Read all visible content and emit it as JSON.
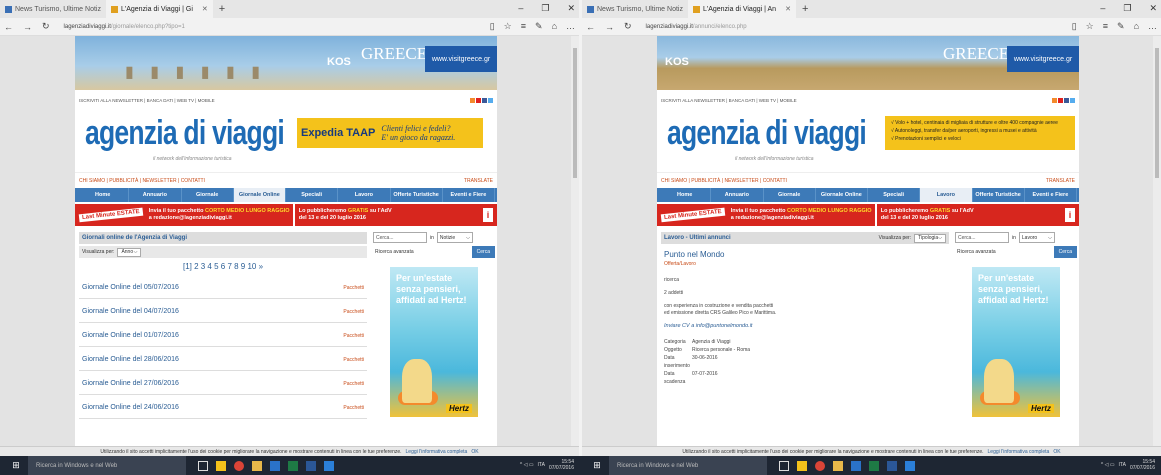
{
  "left": {
    "tabs": [
      {
        "label": "News Turismo, Ultime Notiz",
        "active": false
      },
      {
        "label": "L'Agenzia di Viaggi | Gi",
        "active": true
      }
    ],
    "url_host": "lagenziadiviaggi.it",
    "url_path": "/giornale/elenco.php?tipo=1",
    "banner": {
      "kos": "KOS",
      "greece": "GREECE",
      "site": "www.visitgreece.gr"
    },
    "toplinks": "ISCRIVITI ALLA NEWSLETTER | BANCA DATI | WEB TV | MOBILE",
    "logo": "agenzia di viaggi",
    "logo_sub": "il network dell'informazione turistica",
    "ad": {
      "brand": "Expedia TAAP",
      "line1": "Clienti felici e fedeli?",
      "line2": "E' un gioco da ragazzi."
    },
    "nav1": {
      "links": "CHI SIAMO | PUBBLICITÀ | NEWSLETTER | CONTATTI",
      "translate": "TRANSLATE"
    },
    "menu": [
      "Home",
      "Annuario",
      "Giornale",
      "Giornale Online",
      "Speciali",
      "Lavoro",
      "Offerte Turistiche",
      "Eventi e Fiere"
    ],
    "menu_selected": 3,
    "promo": {
      "badge": "Last Minute ESTATE",
      "a1": "Invia il tuo pacchetto",
      "a_hl": "CORTO  MEDIO  LUNGO RAGGIO",
      "a2": "a redazione@lagenziadiviaggi.it",
      "b1": "Lo pubblicheremo",
      "b_hl": "GRATIS",
      "b2": "su l'AdV",
      "b3": "del 13 e del 20 luglio 2016"
    },
    "section_title": "Giornali online de l'Agenzia di Viaggi",
    "view_label": "Visualizza per:",
    "view_value": "Anno",
    "pages": "[1] 2 3 4 5 6 7 8 9 10 »",
    "rows": [
      {
        "title": "Giornale Online del 05/07/2016",
        "tag": "Pacchetti"
      },
      {
        "title": "Giornale Online del 04/07/2016",
        "tag": "Pacchetti"
      },
      {
        "title": "Giornale Online del 01/07/2016",
        "tag": "Pacchetti"
      },
      {
        "title": "Giornale Online del 28/06/2016",
        "tag": "Pacchetti"
      },
      {
        "title": "Giornale Online del 27/06/2016",
        "tag": "Pacchetti"
      },
      {
        "title": "Giornale Online del 24/06/2016",
        "tag": "Pacchetti"
      }
    ],
    "search": {
      "placeholder": "Cerca...",
      "in": "in",
      "scope": "Notizie",
      "button": "Cerca",
      "advanced": "Ricerca avanzata"
    },
    "hertz": {
      "line1": "Per un'estate",
      "line2": "senza pensieri,",
      "line3": "affidati ad Hertz!",
      "brand": "Hertz"
    }
  },
  "right": {
    "tabs": [
      {
        "label": "News Turismo, Ultime Notiz",
        "active": false
      },
      {
        "label": "L'Agenzia di Viaggi | An",
        "active": true
      }
    ],
    "url_host": "lagenziadiviaggi.it",
    "url_path": "/annunci/elenco.php",
    "banner": {
      "kos": "KOS",
      "greece": "GREECE",
      "site": "www.visitgreece.gr"
    },
    "toplinks": "ISCRIVITI ALLA NEWSLETTER | BANCA DATI | WEB TV | MOBILE",
    "logo": "agenzia di viaggi",
    "logo_sub": "il network dell'informazione turistica",
    "ad_lines": [
      "√ Volo + hotel, centinaia di migliaia di strutture e oltre 400 compagnie aeree",
      "√ Autonoleggi, transfer da/per aeroporti, ingressi a musei e attività",
      "√ Prenotazioni semplici e veloci"
    ],
    "nav1": {
      "links": "CHI SIAMO | PUBBLICITÀ | NEWSLETTER | CONTATTI",
      "translate": "TRANSLATE"
    },
    "menu": [
      "Home",
      "Annuario",
      "Giornale",
      "Giornale Online",
      "Speciali",
      "Lavoro",
      "Offerte Turistiche",
      "Eventi e Fiere"
    ],
    "menu_selected": 5,
    "promo": {
      "badge": "Last Minute ESTATE",
      "a1": "Invia il tuo pacchetto",
      "a_hl": "CORTO  MEDIO  LUNGO RAGGIO",
      "a2": "a redazione@lagenziadiviaggi.it",
      "b1": "Lo pubblicheremo",
      "b_hl": "GRATIS",
      "b2": "su l'AdV",
      "b3": "del 13 e del 20 luglio 2016"
    },
    "section_title": "Lavoro - Ultimi annunci",
    "view_label": "Visualizza per:",
    "view_value": "Tipologia",
    "job": {
      "title": "Punto nel Mondo",
      "sub": "Offerta/Lavoro",
      "ricerca": "ricerca",
      "addetti": "2 addetti",
      "desc1": "con esperienza in costruzione e vendita pacchetti",
      "desc2": "ed emissione diretta CRS Galileo Pico e Marittima.",
      "cv": "Inviare CV a info@puntonelmondo.it",
      "fields": [
        {
          "k": "Categoria",
          "v": "Agenzia di Viaggi"
        },
        {
          "k": "Oggetto",
          "v": "Ricerca personale - Roma"
        },
        {
          "k": "Data inserimento",
          "v": "30-06-2016"
        },
        {
          "k": "Data scadenza",
          "v": "07-07-2016"
        }
      ]
    },
    "search": {
      "placeholder": "Cerca...",
      "in": "in",
      "scope": "Lavoro",
      "button": "Cerca",
      "advanced": "Ricerca avanzata"
    },
    "hertz": {
      "line1": "Per un'estate",
      "line2": "senza pensieri,",
      "line3": "affidati ad Hertz!",
      "brand": "Hertz"
    }
  },
  "cookie": {
    "text": "Utilizzando il sito accetti implicitamente l'uso dei cookie per migliorare la navigazione e mostrare contenuti in linea con le tue preferenze.",
    "link": "Leggi l'informativa completa",
    "ok": "OK"
  },
  "taskbar": {
    "search": "Ricerca in Windows e nel Web",
    "lang": "ITA",
    "time": "15:54",
    "date": "07/07/2016"
  },
  "colors": {
    "brand_blue": "#1e6bb5",
    "nav_blue": "#3d7ab8",
    "promo_red": "#d7261e",
    "accent_orange": "#c84a16"
  }
}
